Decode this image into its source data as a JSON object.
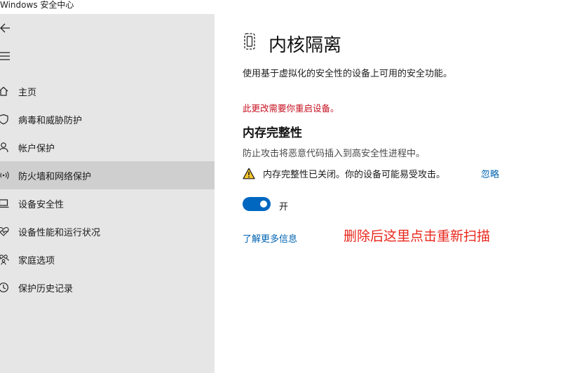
{
  "window": {
    "title": "Windows 安全中心"
  },
  "sidebar": {
    "back_icon": "back-arrow-icon",
    "menu_icon": "hamburger-menu-icon",
    "items": [
      {
        "label": "主页",
        "icon": "home-icon"
      },
      {
        "label": "病毒和威胁防护",
        "icon": "shield-icon"
      },
      {
        "label": "帐户保护",
        "icon": "person-icon"
      },
      {
        "label": "防火墙和网络保护",
        "icon": "wifi-antenna-icon",
        "selected": true
      },
      {
        "label": "设备安全性",
        "icon": "laptop-icon"
      },
      {
        "label": "设备性能和运行状况",
        "icon": "heart-pulse-icon"
      },
      {
        "label": "家庭选项",
        "icon": "family-icon"
      },
      {
        "label": "保护历史记录",
        "icon": "history-icon"
      }
    ]
  },
  "main": {
    "page_icon": "core-isolation-chip-icon",
    "title": "内核隔离",
    "description": "使用基于虚拟化的安全性的设备上可用的安全功能。",
    "restart_note": "此更改需要你重启设备。",
    "section": {
      "title": "内存完整性",
      "description": "防止攻击将恶意代码插入到高安全性进程中。",
      "warning_icon": "warning-triangle-icon",
      "warning_text": "内存完整性已关闭。你的设备可能易受攻击。",
      "dismiss_label": "忽略",
      "toggle_state": "on",
      "toggle_label": "开"
    },
    "learn_more": "了解更多信息",
    "annotation": "删除后这里点击重新扫描"
  },
  "colors": {
    "sidebar_bg": "#e6e6e6",
    "selected_bg": "#cfcfcf",
    "accent": "#0067c0",
    "link": "#0063b1",
    "alert_red": "#c50f1f",
    "annotation_red": "#e8271c"
  }
}
